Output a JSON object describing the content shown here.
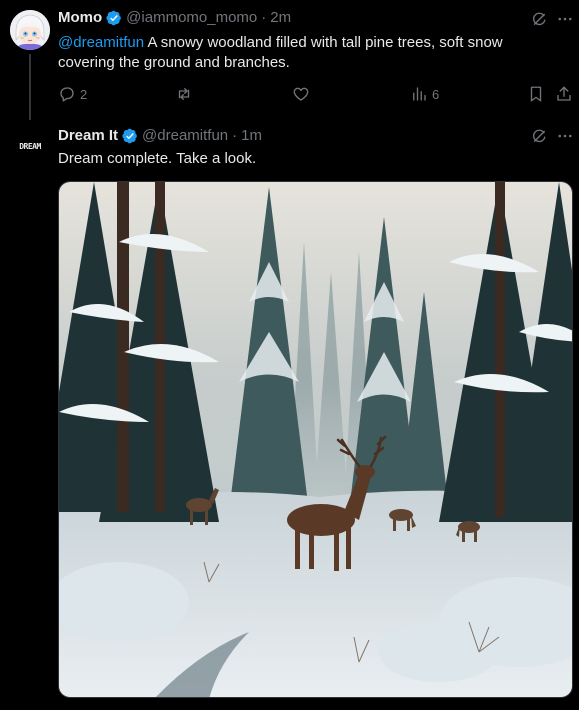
{
  "tweet1": {
    "name": "Momo",
    "handle": "@iammomo_momo",
    "separator": "·",
    "time": "2m",
    "mention": "@dreamitfun",
    "body": " A snowy woodland filled with tall pine trees, soft snow covering the ground and branches.",
    "replies": "2",
    "views": "6"
  },
  "tweet2": {
    "name": "Dream It",
    "avatar_text": "DREAM",
    "handle": "@dreamitfun",
    "separator": "·",
    "time": "1m",
    "body": "Dream complete. Take a look."
  },
  "icons": [
    "verified-badge-icon",
    "grok-icon",
    "more-icon",
    "reply-icon",
    "repost-icon",
    "like-icon",
    "views-icon",
    "bookmark-icon",
    "share-icon"
  ],
  "colors": {
    "accent": "#1d9bf0",
    "muted": "#71767b",
    "text": "#e7e9ea",
    "background": "#000000"
  }
}
